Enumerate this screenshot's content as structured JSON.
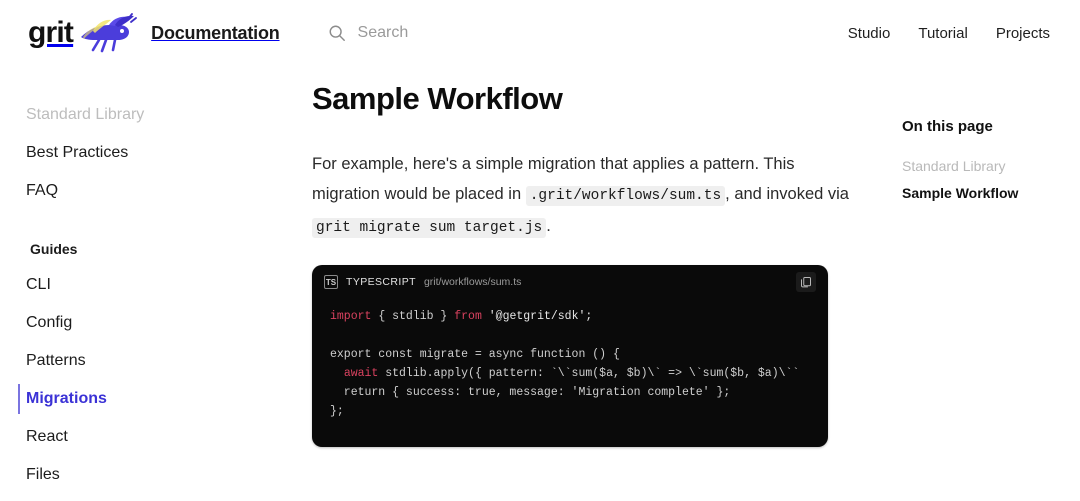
{
  "header": {
    "logo_word": "grit",
    "logo_mascot_icon": "grasshopper-mascot-icon",
    "title": "Documentation",
    "search": {
      "icon": "search-icon",
      "placeholder": "Search",
      "value": "Search"
    },
    "nav": [
      {
        "label": "Studio"
      },
      {
        "label": "Tutorial"
      },
      {
        "label": "Projects"
      }
    ]
  },
  "sidebar": {
    "items": [
      {
        "label": "Standard Library",
        "state": "muted"
      },
      {
        "label": "Best Practices",
        "state": "normal"
      },
      {
        "label": "FAQ",
        "state": "normal"
      }
    ],
    "section_label": "Guides",
    "guides": [
      {
        "label": "CLI",
        "state": "normal"
      },
      {
        "label": "Config",
        "state": "normal"
      },
      {
        "label": "Patterns",
        "state": "normal"
      },
      {
        "label": "Migrations",
        "state": "active"
      },
      {
        "label": "React",
        "state": "normal"
      },
      {
        "label": "Files",
        "state": "normal"
      }
    ]
  },
  "main": {
    "title": "Sample Workflow",
    "paragraph": {
      "part1": "For example, here's a simple migration that applies a pattern. This migration would be placed in ",
      "code1": ".grit/workflows/sum.ts",
      "part2": ", and invoked via ",
      "code2": "grit migrate sum target.js",
      "part3": "."
    },
    "code_block": {
      "lang_badge": "TS",
      "lang_label": "TYPESCRIPT",
      "filename": "grit/workflows/sum.ts",
      "copy_icon": "copy-icon",
      "lines": [
        "import { stdlib } from '@getgrit/sdk';",
        "",
        "export const migrate = async function () {",
        "  await stdlib.apply({ pattern: `\\`sum($a, $b)\\` => \\`sum($b, $a)\\``",
        "  return { success: true, message: 'Migration complete' };",
        "};"
      ]
    }
  },
  "toc": {
    "title": "On this page",
    "items": [
      {
        "label": "Standard Library",
        "state": "normal"
      },
      {
        "label": "Sample Workflow",
        "state": "active"
      }
    ]
  },
  "colors": {
    "accent": "#3b32d6",
    "code_bg": "#0a0a0a",
    "inline_code_bg": "#efefef",
    "keyword": "#d9425f"
  }
}
